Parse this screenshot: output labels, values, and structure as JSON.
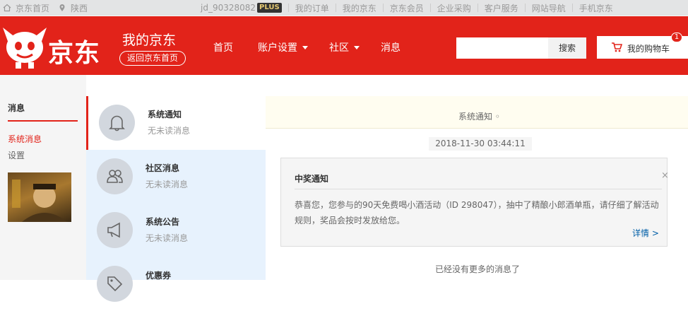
{
  "topbar": {
    "home": "京东首页",
    "location": "陕西",
    "username": "jd_90328082",
    "plus_badge": "PLUS",
    "links": [
      "我的订单",
      "我的京东",
      "京东会员",
      "企业采购",
      "客户服务",
      "网站导航",
      "手机京东"
    ]
  },
  "header": {
    "logo_text": "京东",
    "title": "我的京东",
    "back_home": "返回京东首页",
    "nav": [
      "首页",
      "账户设置",
      "社区",
      "消息"
    ],
    "search_placeholder": "",
    "search_button": "搜索",
    "cart_label": "我的购物车",
    "cart_count": "1",
    "brand_color": "#e2231a"
  },
  "sidebar": {
    "title": "消息",
    "items": [
      "系统消息",
      "设置"
    ]
  },
  "categories": [
    {
      "title": "系统通知",
      "status": "无未读消息",
      "icon": "bell-icon"
    },
    {
      "title": "社区消息",
      "status": "无未读消息",
      "icon": "users-icon"
    },
    {
      "title": "系统公告",
      "status": "无未读消息",
      "icon": "megaphone-icon"
    },
    {
      "title": "优惠券",
      "status": "",
      "icon": "tag-icon"
    }
  ],
  "main": {
    "header": "系统通知",
    "header_mark": "◦",
    "timestamp": "2018-11-30 03:44:11",
    "card": {
      "title": "中奖通知",
      "close": "×",
      "body": "恭喜您，您参与的90天免费喝小酒活动（ID 298047），抽中了精酿小郎酒单瓶，请仔细了解活动规则，奖品会按时发放给您。",
      "more": "详情 >"
    },
    "no_more": "已经没有更多的消息了"
  }
}
